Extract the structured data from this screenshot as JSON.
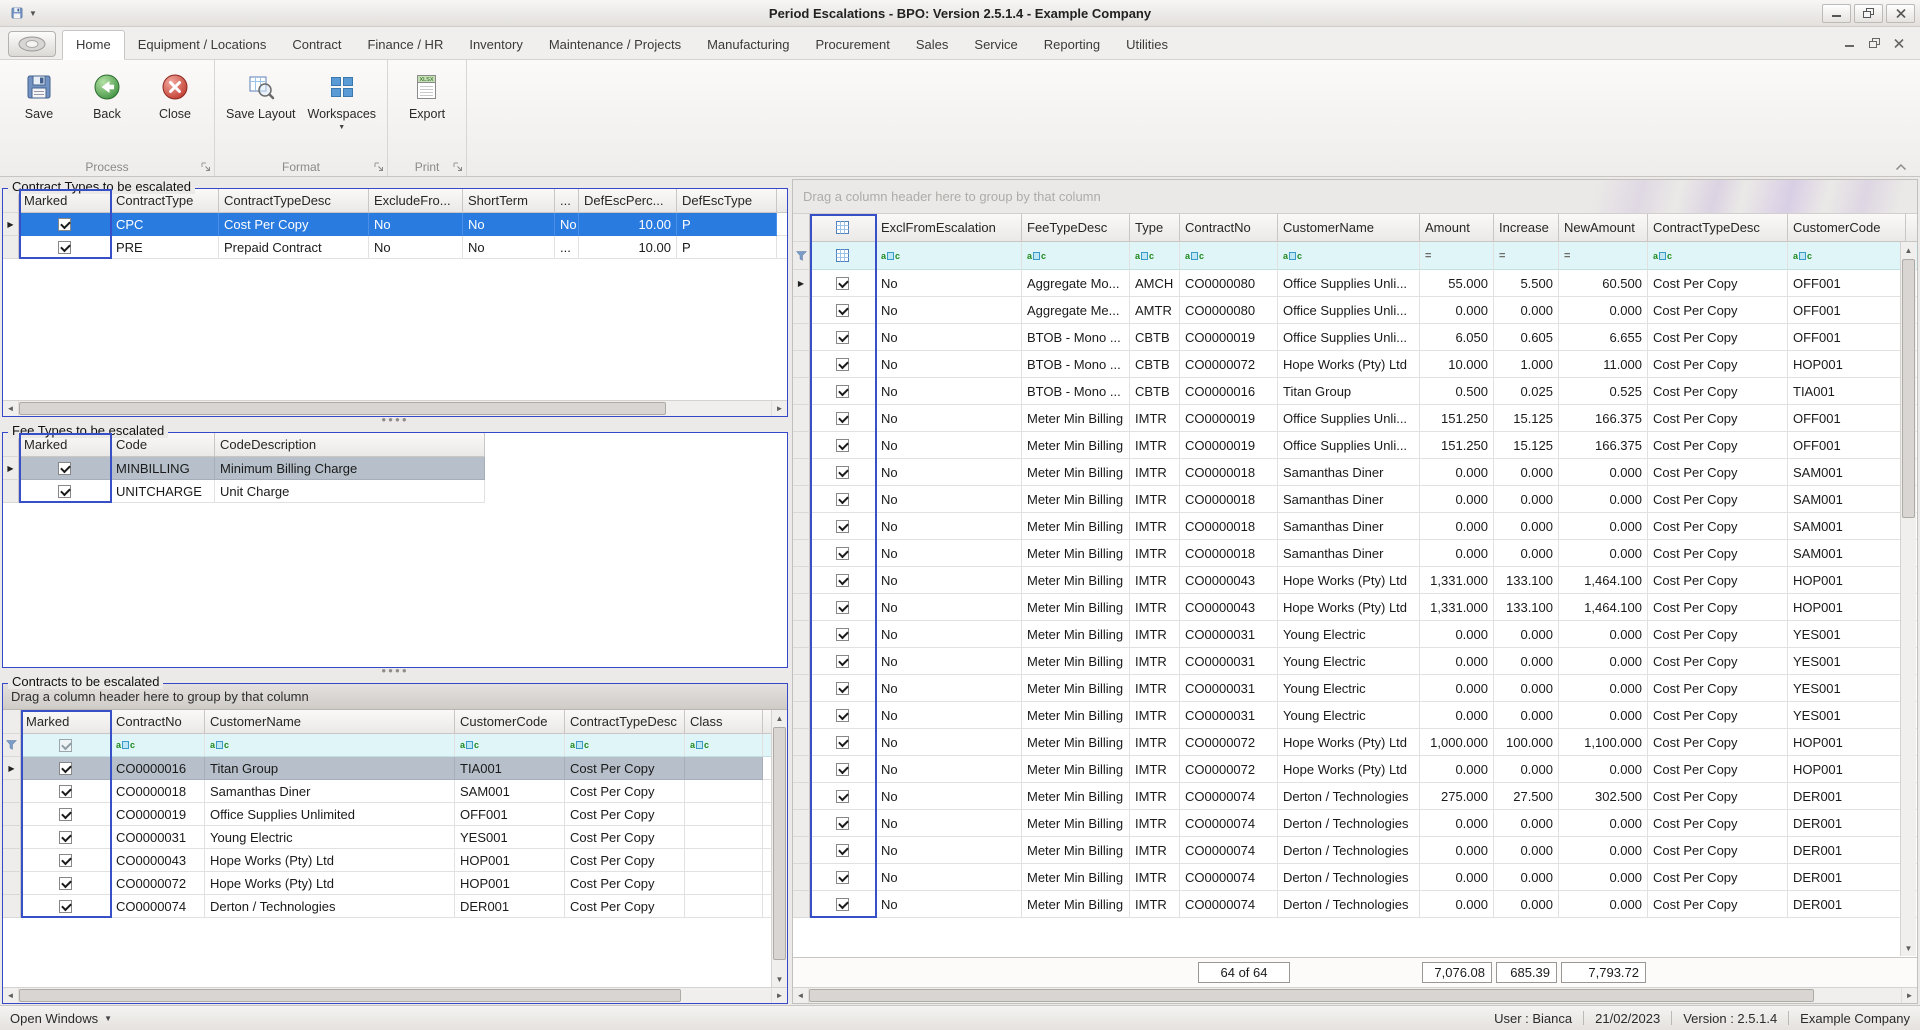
{
  "window": {
    "title": "Period Escalations - BPO: Version 2.5.1.4 - Example Company"
  },
  "icons": {
    "quick_access": "floppy-disk",
    "quick_access_dropdown": "chevron-down",
    "window_controls": [
      "minimize",
      "restore",
      "close"
    ],
    "ribbon_collapse": "chevron-up",
    "row_indicator": "right-arrow",
    "filter_row": "funnel",
    "select_all": "blue-grid",
    "text_filter": "abc",
    "numeric_filter": "equals"
  },
  "ribbon": {
    "active_tab": "Home",
    "tabs": [
      "Home",
      "Equipment / Locations",
      "Contract",
      "Finance / HR",
      "Inventory",
      "Maintenance / Projects",
      "Manufacturing",
      "Procurement",
      "Sales",
      "Service",
      "Reporting",
      "Utilities"
    ],
    "groups": [
      {
        "name": "Process",
        "buttons": [
          {
            "label": "Save",
            "icon": "save-icon"
          },
          {
            "label": "Back",
            "icon": "back-icon"
          },
          {
            "label": "Close",
            "icon": "close-icon"
          }
        ]
      },
      {
        "name": "Format",
        "buttons": [
          {
            "label": "Save Layout",
            "icon": "save-layout-icon"
          },
          {
            "label": "Workspaces",
            "icon": "workspaces-icon",
            "dropdown": true
          }
        ]
      },
      {
        "name": "Print",
        "buttons": [
          {
            "label": "Export",
            "icon": "export-icon"
          }
        ]
      }
    ]
  },
  "contract_types": {
    "title": "Contract Types to be escalated",
    "columns": [
      "Marked",
      "ContractType",
      "ContractTypeDesc",
      "ExcludeFro...",
      "ShortTerm",
      "...",
      "DefEscPerc...",
      "DefEscType"
    ],
    "rows": [
      {
        "marked": true,
        "selected": true,
        "cells": [
          "CPC",
          "Cost Per Copy",
          "No",
          "No",
          "No",
          "10.00",
          "P"
        ]
      },
      {
        "marked": true,
        "selected": false,
        "cells": [
          "PRE",
          "Prepaid Contract",
          "No",
          "No",
          "...",
          "10.00",
          "P"
        ]
      }
    ]
  },
  "fee_types": {
    "title": "Fee Types to be escalated",
    "columns": [
      "Marked",
      "Code",
      "CodeDescription"
    ],
    "rows": [
      {
        "marked": true,
        "selected": true,
        "cells": [
          "MINBILLING",
          "Minimum Billing Charge"
        ]
      },
      {
        "marked": true,
        "selected": false,
        "cells": [
          "UNITCHARGE",
          "Unit Charge"
        ]
      }
    ]
  },
  "contracts": {
    "title": "Contracts to be escalated",
    "groupby_hint": "Drag a column header here to group by that column",
    "columns": [
      "Marked",
      "ContractNo",
      "CustomerName",
      "CustomerCode",
      "ContractTypeDesc",
      "Class"
    ],
    "rows": [
      {
        "marked": true,
        "selected": true,
        "cells": [
          "CO0000016",
          "Titan Group",
          "TIA001",
          "Cost Per Copy",
          ""
        ]
      },
      {
        "marked": true,
        "selected": false,
        "cells": [
          "CO0000018",
          "Samanthas Diner",
          "SAM001",
          "Cost Per Copy",
          ""
        ]
      },
      {
        "marked": true,
        "selected": false,
        "cells": [
          "CO0000019",
          "Office Supplies Unlimited",
          "OFF001",
          "Cost Per Copy",
          ""
        ]
      },
      {
        "marked": true,
        "selected": false,
        "cells": [
          "CO0000031",
          "Young Electric",
          "YES001",
          "Cost Per Copy",
          ""
        ]
      },
      {
        "marked": true,
        "selected": false,
        "cells": [
          "CO0000043",
          "Hope Works (Pty) Ltd",
          "HOP001",
          "Cost Per Copy",
          ""
        ]
      },
      {
        "marked": true,
        "selected": false,
        "cells": [
          "CO0000072",
          "Hope Works (Pty) Ltd",
          "HOP001",
          "Cost Per Copy",
          ""
        ]
      },
      {
        "marked": true,
        "selected": false,
        "cells": [
          "CO0000074",
          "Derton / Technologies",
          "DER001",
          "Cost Per Copy",
          ""
        ]
      }
    ]
  },
  "escalations": {
    "groupby_hint": "Drag a column header here to group by that column",
    "columns": [
      "ExclFromEscalation",
      "FeeTypeDesc",
      "Type",
      "ContractNo",
      "CustomerName",
      "Amount",
      "Increase",
      "NewAmount",
      "ContractTypeDesc",
      "CustomerCode"
    ],
    "rows": [
      {
        "checked": true,
        "cells": [
          "No",
          "Aggregate Mo...",
          "AMCH",
          "CO0000080",
          "Office Supplies Unli...",
          "55.000",
          "5.500",
          "60.500",
          "Cost Per Copy",
          "OFF001"
        ]
      },
      {
        "checked": true,
        "cells": [
          "No",
          "Aggregate Me...",
          "AMTR",
          "CO0000080",
          "Office Supplies Unli...",
          "0.000",
          "0.000",
          "0.000",
          "Cost Per Copy",
          "OFF001"
        ]
      },
      {
        "checked": true,
        "cells": [
          "No",
          "BTOB - Mono ...",
          "CBTB",
          "CO0000019",
          "Office Supplies Unli...",
          "6.050",
          "0.605",
          "6.655",
          "Cost Per Copy",
          "OFF001"
        ]
      },
      {
        "checked": true,
        "cells": [
          "No",
          "BTOB - Mono ...",
          "CBTB",
          "CO0000072",
          "Hope Works (Pty) Ltd",
          "10.000",
          "1.000",
          "11.000",
          "Cost Per Copy",
          "HOP001"
        ]
      },
      {
        "checked": true,
        "cells": [
          "No",
          "BTOB - Mono ...",
          "CBTB",
          "CO0000016",
          "Titan Group",
          "0.500",
          "0.025",
          "0.525",
          "Cost Per Copy",
          "TIA001"
        ]
      },
      {
        "checked": true,
        "cells": [
          "No",
          "Meter Min Billing",
          "IMTR",
          "CO0000019",
          "Office Supplies Unli...",
          "151.250",
          "15.125",
          "166.375",
          "Cost Per Copy",
          "OFF001"
        ]
      },
      {
        "checked": true,
        "cells": [
          "No",
          "Meter Min Billing",
          "IMTR",
          "CO0000019",
          "Office Supplies Unli...",
          "151.250",
          "15.125",
          "166.375",
          "Cost Per Copy",
          "OFF001"
        ]
      },
      {
        "checked": true,
        "cells": [
          "No",
          "Meter Min Billing",
          "IMTR",
          "CO0000018",
          "Samanthas Diner",
          "0.000",
          "0.000",
          "0.000",
          "Cost Per Copy",
          "SAM001"
        ]
      },
      {
        "checked": true,
        "cells": [
          "No",
          "Meter Min Billing",
          "IMTR",
          "CO0000018",
          "Samanthas Diner",
          "0.000",
          "0.000",
          "0.000",
          "Cost Per Copy",
          "SAM001"
        ]
      },
      {
        "checked": true,
        "cells": [
          "No",
          "Meter Min Billing",
          "IMTR",
          "CO0000018",
          "Samanthas Diner",
          "0.000",
          "0.000",
          "0.000",
          "Cost Per Copy",
          "SAM001"
        ]
      },
      {
        "checked": true,
        "cells": [
          "No",
          "Meter Min Billing",
          "IMTR",
          "CO0000018",
          "Samanthas Diner",
          "0.000",
          "0.000",
          "0.000",
          "Cost Per Copy",
          "SAM001"
        ]
      },
      {
        "checked": true,
        "cells": [
          "No",
          "Meter Min Billing",
          "IMTR",
          "CO0000043",
          "Hope Works (Pty) Ltd",
          "1,331.000",
          "133.100",
          "1,464.100",
          "Cost Per Copy",
          "HOP001"
        ]
      },
      {
        "checked": true,
        "cells": [
          "No",
          "Meter Min Billing",
          "IMTR",
          "CO0000043",
          "Hope Works (Pty) Ltd",
          "1,331.000",
          "133.100",
          "1,464.100",
          "Cost Per Copy",
          "HOP001"
        ]
      },
      {
        "checked": true,
        "cells": [
          "No",
          "Meter Min Billing",
          "IMTR",
          "CO0000031",
          "Young Electric",
          "0.000",
          "0.000",
          "0.000",
          "Cost Per Copy",
          "YES001"
        ]
      },
      {
        "checked": true,
        "cells": [
          "No",
          "Meter Min Billing",
          "IMTR",
          "CO0000031",
          "Young Electric",
          "0.000",
          "0.000",
          "0.000",
          "Cost Per Copy",
          "YES001"
        ]
      },
      {
        "checked": true,
        "cells": [
          "No",
          "Meter Min Billing",
          "IMTR",
          "CO0000031",
          "Young Electric",
          "0.000",
          "0.000",
          "0.000",
          "Cost Per Copy",
          "YES001"
        ]
      },
      {
        "checked": true,
        "cells": [
          "No",
          "Meter Min Billing",
          "IMTR",
          "CO0000031",
          "Young Electric",
          "0.000",
          "0.000",
          "0.000",
          "Cost Per Copy",
          "YES001"
        ]
      },
      {
        "checked": true,
        "cells": [
          "No",
          "Meter Min Billing",
          "IMTR",
          "CO0000072",
          "Hope Works (Pty) Ltd",
          "1,000.000",
          "100.000",
          "1,100.000",
          "Cost Per Copy",
          "HOP001"
        ]
      },
      {
        "checked": true,
        "cells": [
          "No",
          "Meter Min Billing",
          "IMTR",
          "CO0000072",
          "Hope Works (Pty) Ltd",
          "0.000",
          "0.000",
          "0.000",
          "Cost Per Copy",
          "HOP001"
        ]
      },
      {
        "checked": true,
        "cells": [
          "No",
          "Meter Min Billing",
          "IMTR",
          "CO0000074",
          "Derton / Technologies",
          "275.000",
          "27.500",
          "302.500",
          "Cost Per Copy",
          "DER001"
        ]
      },
      {
        "checked": true,
        "cells": [
          "No",
          "Meter Min Billing",
          "IMTR",
          "CO0000074",
          "Derton / Technologies",
          "0.000",
          "0.000",
          "0.000",
          "Cost Per Copy",
          "DER001"
        ]
      },
      {
        "checked": true,
        "cells": [
          "No",
          "Meter Min Billing",
          "IMTR",
          "CO0000074",
          "Derton / Technologies",
          "0.000",
          "0.000",
          "0.000",
          "Cost Per Copy",
          "DER001"
        ]
      },
      {
        "checked": true,
        "cells": [
          "No",
          "Meter Min Billing",
          "IMTR",
          "CO0000074",
          "Derton / Technologies",
          "0.000",
          "0.000",
          "0.000",
          "Cost Per Copy",
          "DER001"
        ]
      },
      {
        "checked": true,
        "cells": [
          "No",
          "Meter Min Billing",
          "IMTR",
          "CO0000074",
          "Derton / Technologies",
          "0.000",
          "0.000",
          "0.000",
          "Cost Per Copy",
          "DER001"
        ]
      }
    ],
    "footer": {
      "count": "64 of 64",
      "amount": "7,076.08",
      "increase": "685.39",
      "new_amount": "7,793.72"
    }
  },
  "status_bar": {
    "open_windows": "Open Windows",
    "user": "User : Bianca",
    "date": "21/02/2023",
    "version": "Version : 2.5.1.4",
    "company": "Example Company"
  }
}
